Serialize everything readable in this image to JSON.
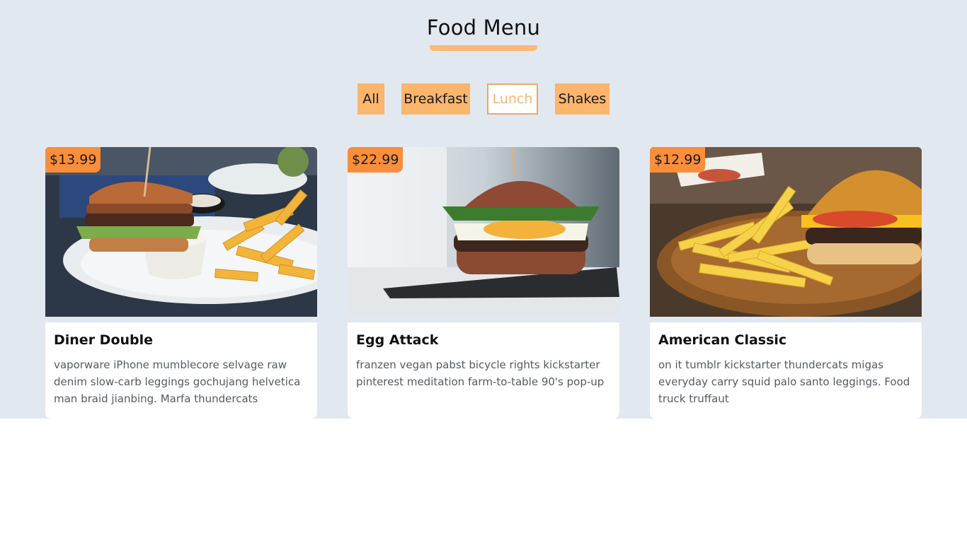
{
  "header": {
    "title": "Food Menu"
  },
  "filters": [
    {
      "label": "All",
      "active": false
    },
    {
      "label": "Breakfast",
      "active": false
    },
    {
      "label": "Lunch",
      "active": true
    },
    {
      "label": "Shakes",
      "active": false
    }
  ],
  "colors": {
    "background": "#e2e8f0",
    "accent": "#fbb56c",
    "price_badge": "#fa8e3a",
    "card": "#ffffff"
  },
  "items": [
    {
      "price": "$13.99",
      "name": "Diner Double",
      "desc": "vaporware iPhone mumblecore selvage raw denim slow-carb leggings gochujang helvetica man braid jianbing. Marfa thundercats",
      "image_icon": "burger-fries-plate-photo"
    },
    {
      "price": "$22.99",
      "name": "Egg Attack",
      "desc": "franzen vegan pabst bicycle rights kickstarter pinterest meditation farm-to-table 90's pop-up",
      "image_icon": "egg-burger-photo"
    },
    {
      "price": "$12.99",
      "name": "American Classic",
      "desc": "on it tumblr kickstarter thundercats migas everyday carry squid palo santo leggings. Food truck truffaut",
      "image_icon": "cheeseburger-fries-board-photo"
    }
  ]
}
